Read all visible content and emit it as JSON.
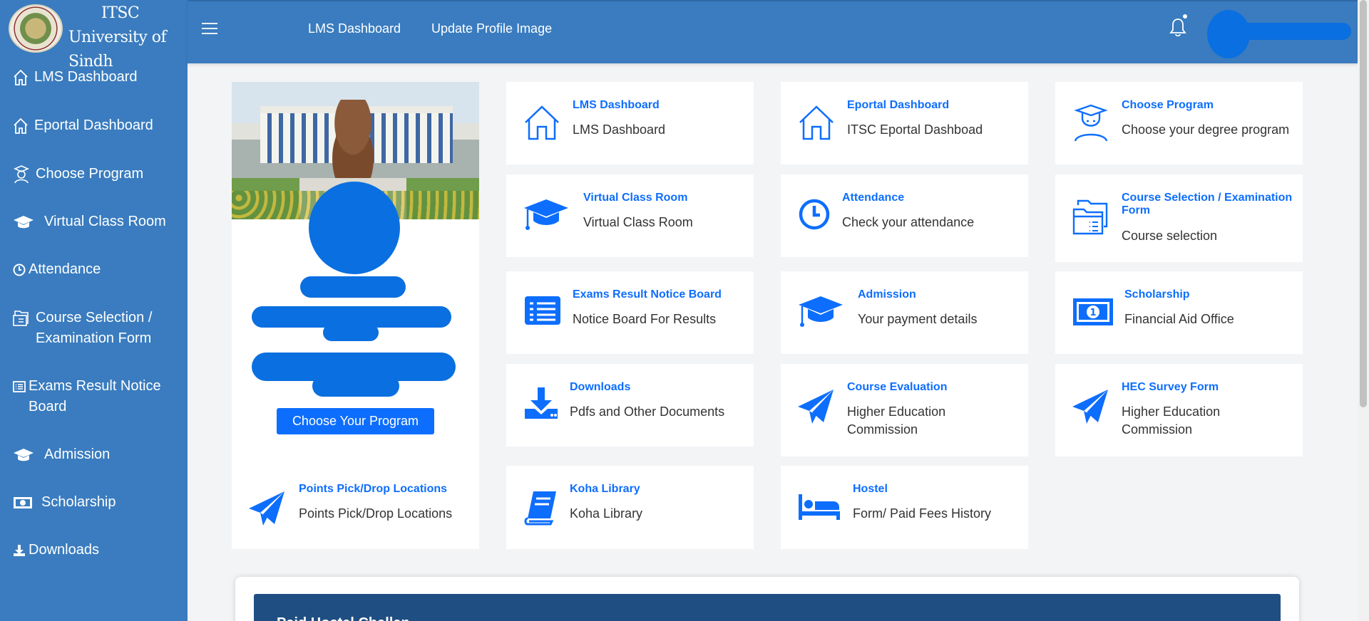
{
  "brand": {
    "line1": "ITSC",
    "line2": "University of Sindh"
  },
  "sidebar": {
    "items": [
      {
        "label": "LMS Dashboard",
        "icon": "home-icon"
      },
      {
        "label": "Eportal Dashboard",
        "icon": "home-icon"
      },
      {
        "label": "Choose Program",
        "icon": "graduate-icon"
      },
      {
        "label": "Virtual Class Room",
        "icon": "graduation-cap-icon"
      },
      {
        "label": "Attendance",
        "icon": "clock-icon"
      },
      {
        "label": "Course Selection / Examination Form",
        "icon": "folder-icon"
      },
      {
        "label": "Exams Result Notice Board",
        "icon": "list-icon"
      },
      {
        "label": "Admission",
        "icon": "graduation-cap-icon"
      },
      {
        "label": "Scholarship",
        "icon": "money-icon"
      },
      {
        "label": "Downloads",
        "icon": "download-icon"
      }
    ]
  },
  "topbar": {
    "nav": [
      "LMS Dashboard",
      "Update Profile Image"
    ]
  },
  "profile": {
    "button_label": "Choose Your Program"
  },
  "cards": [
    {
      "title": "LMS Dashboard",
      "subtitle": "LMS Dashboard",
      "icon": "home-icon"
    },
    {
      "title": "Eportal Dashboard",
      "subtitle": "ITSC Eportal Dashboad",
      "icon": "home-icon"
    },
    {
      "title": "Choose Program",
      "subtitle": "Choose your degree program",
      "icon": "graduate-icon"
    },
    {
      "title": "Virtual Class Room",
      "subtitle": "Virtual Class Room",
      "icon": "graduation-cap-icon"
    },
    {
      "title": "Attendance",
      "subtitle": "Check your attendance",
      "icon": "clock-icon"
    },
    {
      "title": "Course Selection / Examination Form",
      "subtitle": "Course selection",
      "icon": "folder-icon"
    },
    {
      "title": "Exams Result Notice Board",
      "subtitle": "Notice Board For Results",
      "icon": "list-icon"
    },
    {
      "title": "Admission",
      "subtitle": "Your payment details",
      "icon": "graduation-cap-icon"
    },
    {
      "title": "Scholarship",
      "subtitle": "Financial Aid Office",
      "icon": "money-icon"
    },
    {
      "title": "Downloads",
      "subtitle": "Pdfs and Other Documents",
      "icon": "download-icon"
    },
    {
      "title": "Course Evaluation",
      "subtitle": "Higher Education Commission",
      "icon": "paper-plane-icon"
    },
    {
      "title": "HEC Survey Form",
      "subtitle": "Higher Education Commission",
      "icon": "paper-plane-icon"
    },
    {
      "title": "Points Pick/Drop Locations",
      "subtitle": "Points Pick/Drop Locations",
      "icon": "paper-plane-icon"
    },
    {
      "title": "Koha Library",
      "subtitle": "Koha Library",
      "icon": "book-icon"
    },
    {
      "title": "Hostel",
      "subtitle": "Form/ Paid Fees History",
      "icon": "bed-icon"
    }
  ],
  "bottom_panel": {
    "heading": "Paid Hostel Challan"
  },
  "colors": {
    "sidebar_bg": "#3a7cbf",
    "accent": "#0d6efd",
    "panel_header": "#1f4e82"
  }
}
